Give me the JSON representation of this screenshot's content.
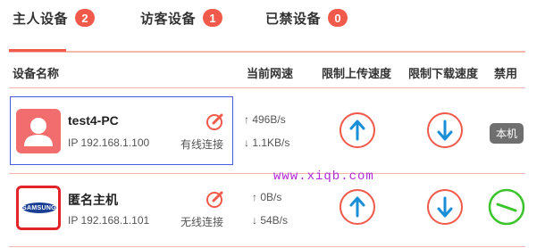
{
  "tabs": [
    {
      "label": "主人设备",
      "count": "2",
      "active": true
    },
    {
      "label": "访客设备",
      "count": "1",
      "active": false
    },
    {
      "label": "已禁设备",
      "count": "0",
      "active": false
    }
  ],
  "columns": {
    "device_name": "设备名称",
    "current_speed": "当前网速",
    "upload_limit": "限制上传速度",
    "download_limit": "限制下载速度",
    "ban": "禁用"
  },
  "devices": [
    {
      "name": "test4-PC",
      "ip": "IP 192.168.1.100",
      "connection": "有线连接",
      "upload_speed": "↑ 496B/s",
      "download_speed": "↓ 1.1KB/s",
      "ban_label": "本机",
      "avatar": "user-icon"
    },
    {
      "name": "匿名主机",
      "ip": "IP 192.168.1.101",
      "connection": "无线连接",
      "upload_speed": "↑ 0B/s",
      "download_speed": "↓ 54B/s",
      "avatar": "samsung-logo",
      "avatar_text": "SAMSUNG"
    }
  ],
  "watermark": "www.xiqb.com",
  "colors": {
    "accent": "#f15a4a",
    "upload_arrow": "#1a8fd8",
    "ban_toggle": "#3cc42c"
  }
}
